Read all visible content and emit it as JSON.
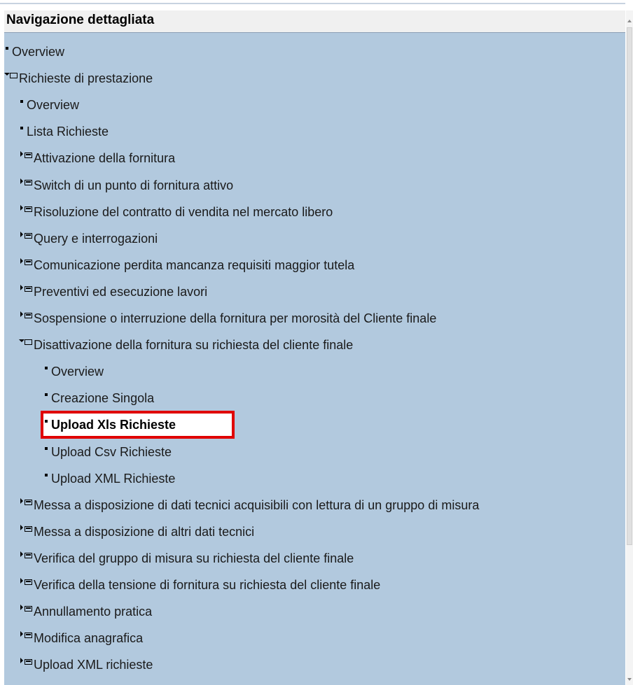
{
  "header": {
    "title": "Navigazione dettagliata"
  },
  "tree": {
    "items": [
      {
        "label": "Overview",
        "type": "leaf",
        "indent": 0
      },
      {
        "label": "Richieste di prestazione",
        "type": "folder-open",
        "indent": 0
      },
      {
        "label": "Overview",
        "type": "leaf",
        "indent": 1
      },
      {
        "label": "Lista Richieste",
        "type": "leaf",
        "indent": 1
      },
      {
        "label": "Attivazione della fornitura",
        "type": "folder-closed",
        "indent": 1
      },
      {
        "label": "Switch di un punto di fornitura attivo",
        "type": "folder-closed",
        "indent": 1
      },
      {
        "label": "Risoluzione del contratto di vendita nel mercato libero",
        "type": "folder-closed",
        "indent": 1
      },
      {
        "label": "Query e interrogazioni",
        "type": "folder-closed",
        "indent": 1
      },
      {
        "label": "Comunicazione perdita mancanza requisiti maggior tutela",
        "type": "folder-closed",
        "indent": 1
      },
      {
        "label": "Preventivi ed esecuzione lavori",
        "type": "folder-closed",
        "indent": 1
      },
      {
        "label": "Sospensione o interruzione della fornitura per morosità del Cliente finale",
        "type": "folder-closed",
        "indent": 1
      },
      {
        "label": "Disattivazione della fornitura su richiesta del cliente finale",
        "type": "folder-open",
        "indent": 1
      },
      {
        "label": "Overview",
        "type": "leaf",
        "indent": 2
      },
      {
        "label": "Creazione Singola",
        "type": "leaf",
        "indent": 2
      },
      {
        "label": "Upload Xls Richieste",
        "type": "leaf",
        "indent": 2,
        "selected": true
      },
      {
        "label": "Upload Csv Richieste",
        "type": "leaf",
        "indent": 2
      },
      {
        "label": "Upload XML Richieste",
        "type": "leaf",
        "indent": 2
      },
      {
        "label": "Messa a disposizione di dati tecnici acquisibili con lettura di un gruppo di misura",
        "type": "folder-closed",
        "indent": 1
      },
      {
        "label": "Messa a disposizione di altri dati tecnici",
        "type": "folder-closed",
        "indent": 1
      },
      {
        "label": "Verifica del gruppo di misura su richiesta del cliente finale",
        "type": "folder-closed",
        "indent": 1
      },
      {
        "label": "Verifica della tensione di fornitura su richiesta del cliente finale",
        "type": "folder-closed",
        "indent": 1
      },
      {
        "label": "Annullamento pratica",
        "type": "folder-closed",
        "indent": 1
      },
      {
        "label": "Modifica anagrafica",
        "type": "folder-closed",
        "indent": 1
      },
      {
        "label": "Upload XML richieste",
        "type": "folder-closed",
        "indent": 1
      }
    ]
  },
  "colors": {
    "tree_background": "#b2c9de",
    "highlight_border": "#e00000",
    "header_background": "#f0f0f0"
  }
}
